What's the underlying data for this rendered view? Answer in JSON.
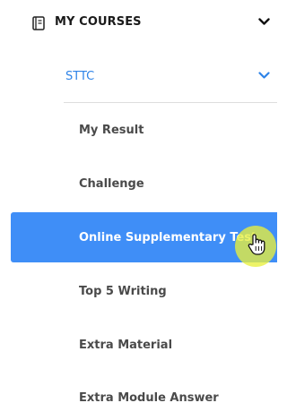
{
  "sidebar": {
    "section": {
      "label": "MY COURSES",
      "icon": "notebook-icon",
      "toggle_icon": "chevron-down-icon"
    },
    "subgroup": {
      "label": "STTC",
      "toggle_icon": "chevron-down-icon",
      "color": "#2f84e8"
    },
    "items": [
      {
        "label": "My Result",
        "active": false
      },
      {
        "label": "Challenge",
        "active": false
      },
      {
        "label": "Online Supplementary Test",
        "active": true
      },
      {
        "label": "Top 5 Writing",
        "active": false
      },
      {
        "label": "Extra Material",
        "active": false
      },
      {
        "label": "Extra Module Answer",
        "active": false
      }
    ]
  },
  "colors": {
    "active_background": "#3f8ef7",
    "active_text": "#ffffff",
    "item_text": "#4a4a4a",
    "cursor_highlight": "#e8f03c"
  },
  "cursor": {
    "icon": "hand-pointer-icon"
  }
}
